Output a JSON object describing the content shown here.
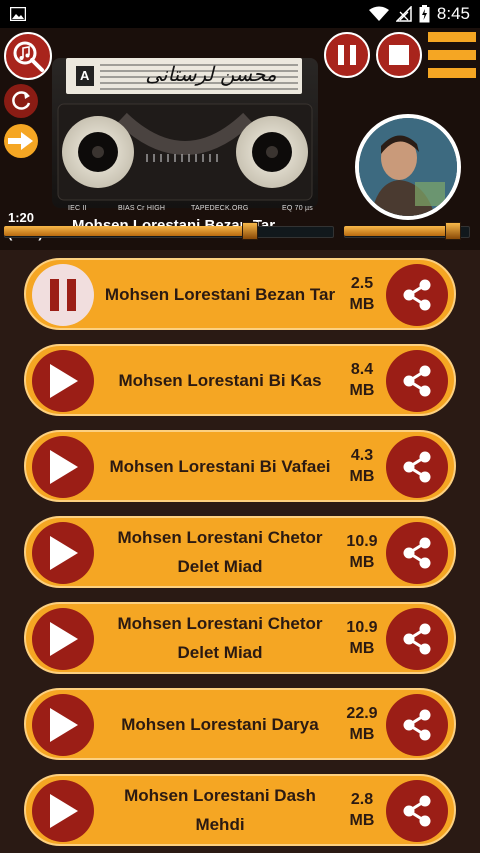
{
  "status_bar": {
    "time": "8:45"
  },
  "player": {
    "elapsed": "1:20",
    "duration": "(1:46)",
    "now_playing": "Mohsen Lorestani Bezan Tar",
    "cassette_side": "A",
    "cassette_label_script": "محسن لرستانی",
    "deck_labels": [
      "IEC II",
      "BIAS Cr HIGH",
      "TAPEDECK.ORG",
      "EQ 70 µs"
    ],
    "progress_fraction": 0.75,
    "volume_fraction": 0.88
  },
  "tracks": [
    {
      "title": "Mohsen Lorestani Bezan Tar",
      "size": "2.5\nMB",
      "state": "playing"
    },
    {
      "title": "Mohsen Lorestani Bi Kas",
      "size": "8.4\nMB",
      "state": "stopped"
    },
    {
      "title": "Mohsen Lorestani Bi Vafaei",
      "size": "4.3\nMB",
      "state": "stopped"
    },
    {
      "title": "Mohsen Lorestani Chetor\nDelet Miad",
      "size": "10.9\nMB",
      "state": "stopped"
    },
    {
      "title": "Mohsen Lorestani Chetor\nDelet Miad",
      "size": "10.9\nMB",
      "state": "stopped"
    },
    {
      "title": "Mohsen Lorestani Darya",
      "size": "22.9\nMB",
      "state": "stopped"
    },
    {
      "title": "Mohsen Lorestani Dash\nMehdi",
      "size": "2.8\nMB",
      "state": "stopped"
    }
  ],
  "icons": {
    "search": "music-search-icon",
    "repeat": "repeat-icon",
    "next": "next-arrow-icon",
    "pause": "pause-icon",
    "stop": "stop-icon",
    "menu": "hamburger-menu-icon",
    "play": "play-icon",
    "share": "share-icon"
  },
  "colors": {
    "accent_orange": "#f5a623",
    "button_red": "#9b1e16",
    "background": "#2a1a14"
  }
}
